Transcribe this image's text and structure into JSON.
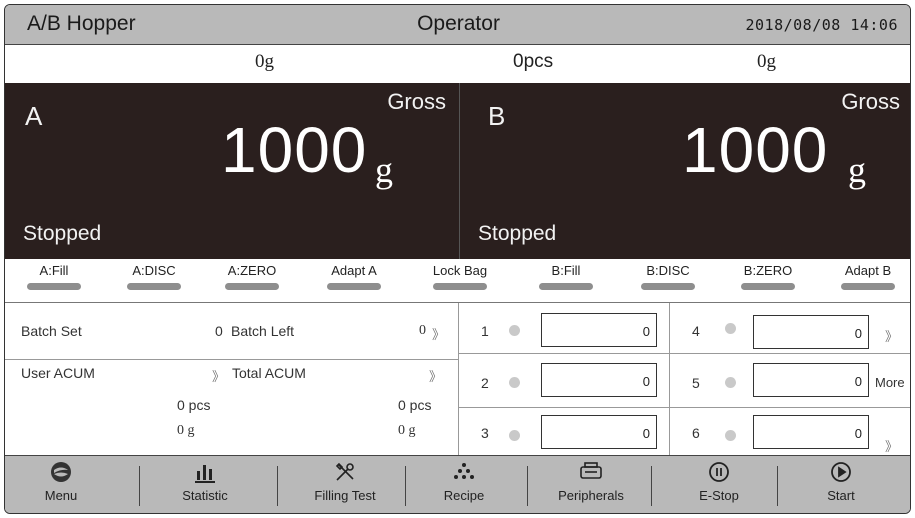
{
  "header": {
    "app_title": "A/B Hopper",
    "role": "Operator",
    "datetime": "2018/08/08 14:06"
  },
  "summary": {
    "left_weight": "0g",
    "count": "0pcs",
    "right_weight": "0g"
  },
  "scale_a": {
    "letter": "A",
    "mode": "Gross",
    "value": "1000",
    "unit": "g",
    "status": "Stopped"
  },
  "scale_b": {
    "letter": "B",
    "mode": "Gross",
    "value": "1000",
    "unit": "g",
    "status": "Stopped"
  },
  "actions": [
    {
      "label": "A:Fill"
    },
    {
      "label": "A:DISC"
    },
    {
      "label": "A:ZERO"
    },
    {
      "label": "Adapt A"
    },
    {
      "label": "Lock Bag"
    },
    {
      "label": "B:Fill"
    },
    {
      "label": "B:DISC"
    },
    {
      "label": "B:ZERO"
    },
    {
      "label": "Adapt B"
    }
  ],
  "batch": {
    "batch_set_label": "Batch Set",
    "batch_set_value": "0",
    "batch_left_label": "Batch Left",
    "batch_left_value": "0",
    "user_acum_label": "User ACUM",
    "total_acum_label": "Total ACUM",
    "user_pcs": "0 pcs",
    "user_g": "0 g",
    "total_pcs": "0 pcs",
    "total_g": "0 g",
    "chevron": "》"
  },
  "slots": [
    {
      "num": "1",
      "value": "0"
    },
    {
      "num": "2",
      "value": "0"
    },
    {
      "num": "3",
      "value": "0"
    },
    {
      "num": "4",
      "value": "0"
    },
    {
      "num": "5",
      "value": "0"
    },
    {
      "num": "6",
      "value": "0"
    }
  ],
  "more_label": "More",
  "nav": [
    {
      "label": "Menu",
      "icon": "logo-icon"
    },
    {
      "label": "Statistic",
      "icon": "bar-chart-icon"
    },
    {
      "label": "Filling Test",
      "icon": "tools-icon"
    },
    {
      "label": "Recipe",
      "icon": "dots-pyramid-icon"
    },
    {
      "label": "Peripherals",
      "icon": "printer-icon"
    },
    {
      "label": "E-Stop",
      "icon": "pause-circle-icon"
    },
    {
      "label": "Start",
      "icon": "play-circle-icon"
    }
  ],
  "colors": {
    "header_bg": "#b9b9b9",
    "weight_panel_bg": "#2a1f1e",
    "button_bar": "#8e8e8e",
    "indicator_dot": "#c9c9c9"
  }
}
